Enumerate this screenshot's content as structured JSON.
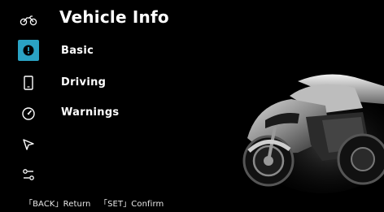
{
  "header": {
    "title": "Vehicle Info",
    "icon": "motorcycle-icon"
  },
  "menu": {
    "items": [
      {
        "label": "Basic",
        "icon": "info-circle-icon",
        "selected": true
      },
      {
        "label": "Driving",
        "icon": "phone-icon",
        "selected": false
      },
      {
        "label": "Warnings",
        "icon": "gauge-icon",
        "selected": false
      }
    ]
  },
  "rail": {
    "extra_icons": [
      "navigation-arrow-icon",
      "settings-sliders-icon"
    ]
  },
  "footer": {
    "back_key": "「BACK」",
    "back_action": "Return",
    "set_key": "「SET」",
    "set_action": "Confirm"
  },
  "colors": {
    "accent": "#2aa3c4",
    "background": "#000000",
    "text": "#ffffff"
  }
}
